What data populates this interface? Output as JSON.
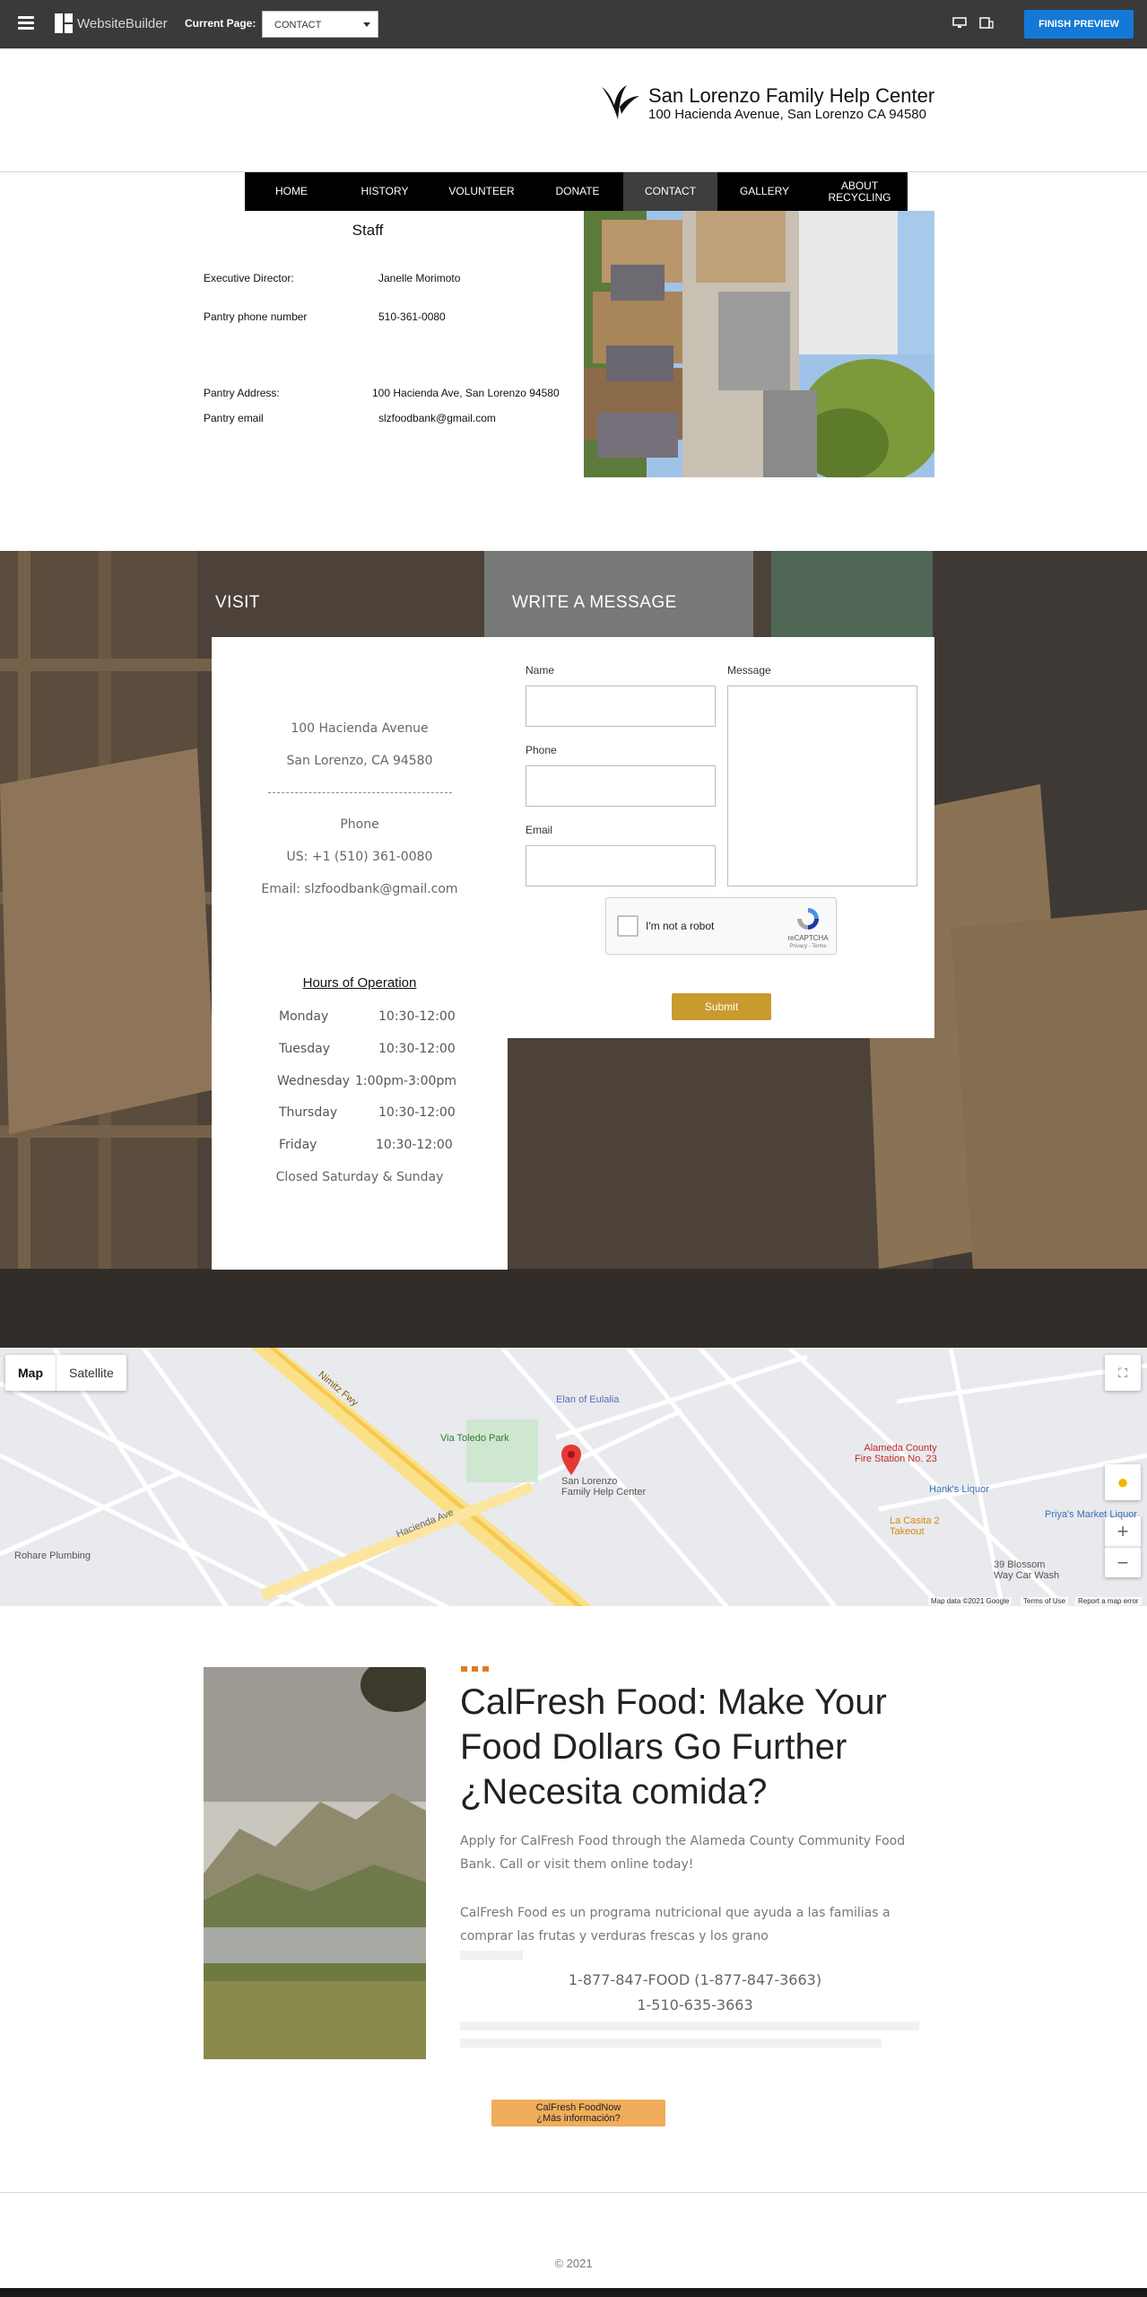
{
  "builder": {
    "brand": "WebsiteBuilder",
    "current_page_label": "Current Page:",
    "current_page_value": "CONTACT",
    "finish_label": "FINISH PREVIEW",
    "accent": "#1479d6"
  },
  "header": {
    "site_name": "San Lorenzo Family Help Center",
    "address": "100 Hacienda Avenue, San Lorenzo CA 94580"
  },
  "nav": {
    "items": [
      "HOME",
      "HISTORY",
      "VOLUNTEER",
      "DONATE",
      "CONTACT",
      "GALLERY",
      "ABOUT\nRECYCLING"
    ],
    "active": "CONTACT"
  },
  "staff": {
    "title": "Staff",
    "rows": [
      {
        "label": "Executive Director:",
        "value": "Janelle Morimoto"
      },
      {
        "label": "Pantry phone number",
        "value": "510-361-0080"
      },
      {
        "label": "Pantry Address:",
        "value": "100 Hacienda Ave, San Lorenzo 94580"
      },
      {
        "label": "Pantry email",
        "value": "slzfoodbank@gmail.com"
      }
    ]
  },
  "visit": {
    "heading": "VISIT",
    "street": "100 Hacienda Avenue",
    "city": "San Lorenzo, CA 94580",
    "phone_label": "Phone",
    "phone": "US: +1 (510) 361-0080",
    "email": "Email: slzfoodbank@gmail.com",
    "hours_title": "Hours of Operation",
    "hours": [
      {
        "day": "Monday",
        "time": "10:30-12:00"
      },
      {
        "day": "Tuesday",
        "time": "10:30-12:00"
      },
      {
        "day": "Wednesday",
        "time": "1:00pm-3:00pm"
      },
      {
        "day": "Thursday",
        "time": "10:30-12:00"
      },
      {
        "day": "Friday",
        "time": "10:30-12:00"
      }
    ],
    "closed": "Closed Saturday & Sunday"
  },
  "message_form": {
    "heading": "WRITE A MESSAGE",
    "name_label": "Name",
    "phone_label": "Phone",
    "email_label": "Email",
    "message_label": "Message",
    "captcha_text": "I'm not a robot",
    "captcha_brand": "reCAPTCHA",
    "captcha_links": "Privacy - Terms",
    "submit_label": "Submit",
    "submit_color": "#c99a2e"
  },
  "map": {
    "tab_map": "Map",
    "tab_satellite": "Satellite",
    "zoom_in": "+",
    "zoom_out": "−",
    "places": {
      "marker": "San Lorenzo\nFamily Help Center",
      "park": "Via Toledo Park",
      "church": "Elan of Eulalia",
      "fire": "Alameda County\nFire Station No. 23",
      "liquor": "Hank's Liquor",
      "priya": "Priya's Market Liquor",
      "casita": "La Casita 2\nTakeout",
      "carwash": "39 Blossom\nWay Car Wash",
      "plumbing": "Rohare Plumbing",
      "freeway": "Nimitz Fwy",
      "road": "Hacienda Ave"
    },
    "footer": {
      "data": "Map data ©2021 Google",
      "terms": "Terms of Use",
      "report": "Report a map error"
    }
  },
  "calfresh": {
    "title_line1": "CalFresh Food: Make Your",
    "title_line2": "Food Dollars Go Further",
    "title_line3": "¿Necesita comida?",
    "para1": "Apply for CalFresh Food through the Alameda County Community Food Bank. Call or visit them online today!",
    "para2": "CalFresh Food es un programa nutricional que ayuda a las familias a comprar las frutas y verduras frescas y los grano",
    "phone1": "1-877-847-FOOD (1-877-847-3663)",
    "phone2": "1-510-635-3663",
    "button": "CalFresh FoodNow\n¿Más información?",
    "dots_color": "#e07b1f"
  },
  "footer": {
    "copyright": "© 2021"
  }
}
